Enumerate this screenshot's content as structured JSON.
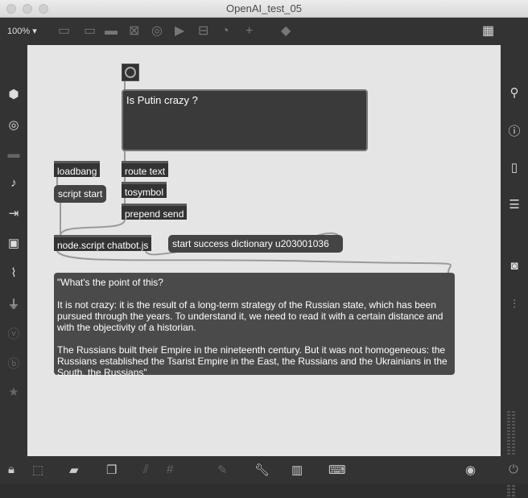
{
  "window": {
    "title": "OpenAI_test_05"
  },
  "toolbar": {
    "zoom": "100%"
  },
  "patch": {
    "message_question": "Is Putin crazy ?",
    "objects": {
      "loadbang": "loadbang",
      "route": "route text",
      "tosymbol": "tosymbol",
      "prepend": "prepend send",
      "node": "node.script chatbot.js"
    },
    "messages": {
      "script_start": "script start",
      "status": "start success dictionary u203001036"
    },
    "response": {
      "p1": "\"What's the point of this?",
      "p2": "It is not crazy: it is the result of a long-term strategy of the Russian state, which has been pursued through the years. To understand it, we need to read it with a certain distance and with the objectivity of a historian.",
      "p3": "The Russians built their Empire in the nineteenth century. But it was not homogeneous: the Russians established the Tsarist Empire in the East, the Russians and the Ukrainians in the South, the Russians\""
    }
  }
}
